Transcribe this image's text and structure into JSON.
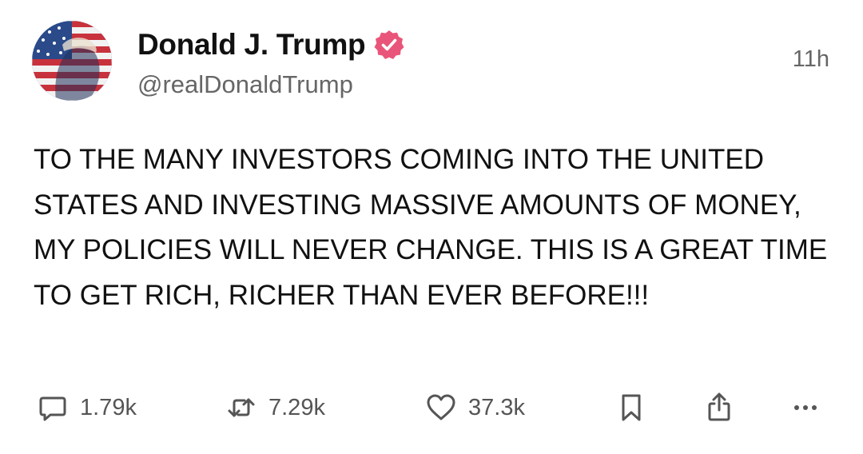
{
  "post": {
    "author": {
      "display_name": "Donald J. Trump",
      "handle": "@realDonaldTrump",
      "verified": true,
      "avatar_icon": "avatar-image",
      "verified_icon": "verified-badge-icon"
    },
    "timestamp": "11h",
    "text": "TO THE MANY INVESTORS COMING INTO THE UNITED STATES AND INVESTING MASSIVE AMOUNTS OF MONEY, MY POLICIES WILL NEVER CHANGE. THIS IS A GREAT TIME TO GET RICH, RICHER THAN EVER BEFORE!!!",
    "actions": {
      "reply": {
        "icon": "reply-icon",
        "count": "1.79k"
      },
      "repost": {
        "icon": "repost-icon",
        "count": "7.29k"
      },
      "like": {
        "icon": "heart-icon",
        "count": "37.3k"
      },
      "bookmark": {
        "icon": "bookmark-icon"
      },
      "share": {
        "icon": "share-icon"
      },
      "more": {
        "icon": "more-icon"
      }
    }
  },
  "colors": {
    "text": "#111111",
    "secondary_text": "#666666",
    "icon": "#555555",
    "verified_badge": "#e9557a",
    "background": "#ffffff"
  }
}
